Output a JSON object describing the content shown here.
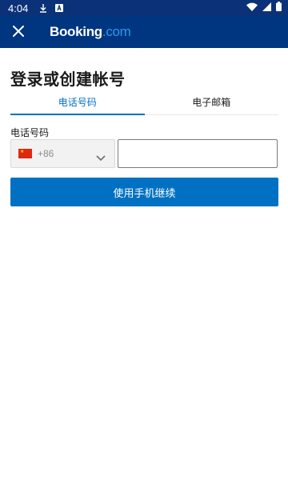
{
  "status_bar": {
    "time": "4:04",
    "icons": [
      "download-icon",
      "a-icon",
      "wifi-icon",
      "signal-icon",
      "battery-icon"
    ]
  },
  "app_bar": {
    "logo_main": "Booking",
    "logo_suffix": ".com",
    "close_icon": "close-icon",
    "background_color": "#003580",
    "logo_accent_color": "#2b9ae8"
  },
  "page": {
    "title": "登录或创建帐号"
  },
  "tabs": [
    {
      "label": "电话号码",
      "active": true
    },
    {
      "label": "电子邮箱",
      "active": false
    }
  ],
  "form": {
    "phone_label": "电话号码",
    "country_flag_icon": "china-flag-icon",
    "dial_code": "+86",
    "phone_value": "",
    "phone_placeholder": ""
  },
  "actions": {
    "continue_label": "使用手机继续",
    "accent_color": "#0071c2"
  }
}
